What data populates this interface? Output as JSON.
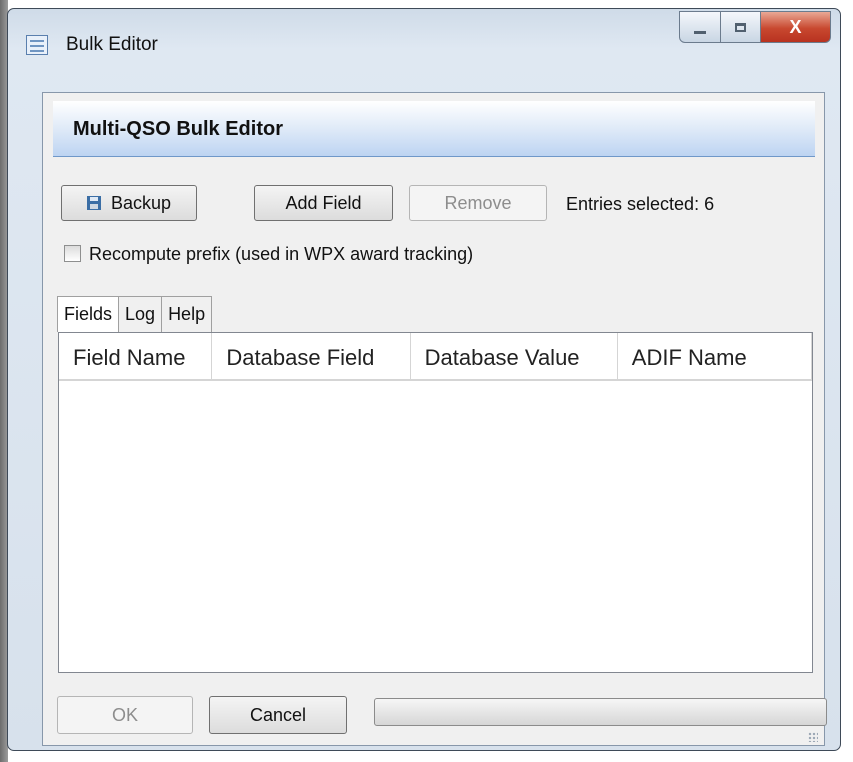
{
  "window": {
    "title": "Bulk Editor",
    "close_glyph": "X"
  },
  "banner": {
    "title": "Multi-QSO Bulk Editor"
  },
  "toolbar": {
    "backup_label": "Backup",
    "add_field_label": "Add Field",
    "remove_label": "Remove",
    "entries_selected": "Entries selected: 6"
  },
  "options": {
    "recompute_prefix_label": "Recompute prefix (used in WPX award tracking)",
    "recompute_prefix_checked": false
  },
  "tabs": [
    {
      "label": "Fields",
      "active": true
    },
    {
      "label": "Log",
      "active": false
    },
    {
      "label": "Help",
      "active": false
    }
  ],
  "table": {
    "columns": [
      "Field Name",
      "Database Field",
      "Database Value",
      "ADIF Name"
    ],
    "rows": []
  },
  "footer": {
    "ok_label": "OK",
    "cancel_label": "Cancel",
    "progress": 0
  },
  "icons": {
    "app": "bulk-editor-icon",
    "backup": "floppy-disk-icon"
  },
  "colors": {
    "banner_bottom": "#bdd4f2",
    "close_button": "#c8482f",
    "window_frame": "#d7e1ec"
  }
}
